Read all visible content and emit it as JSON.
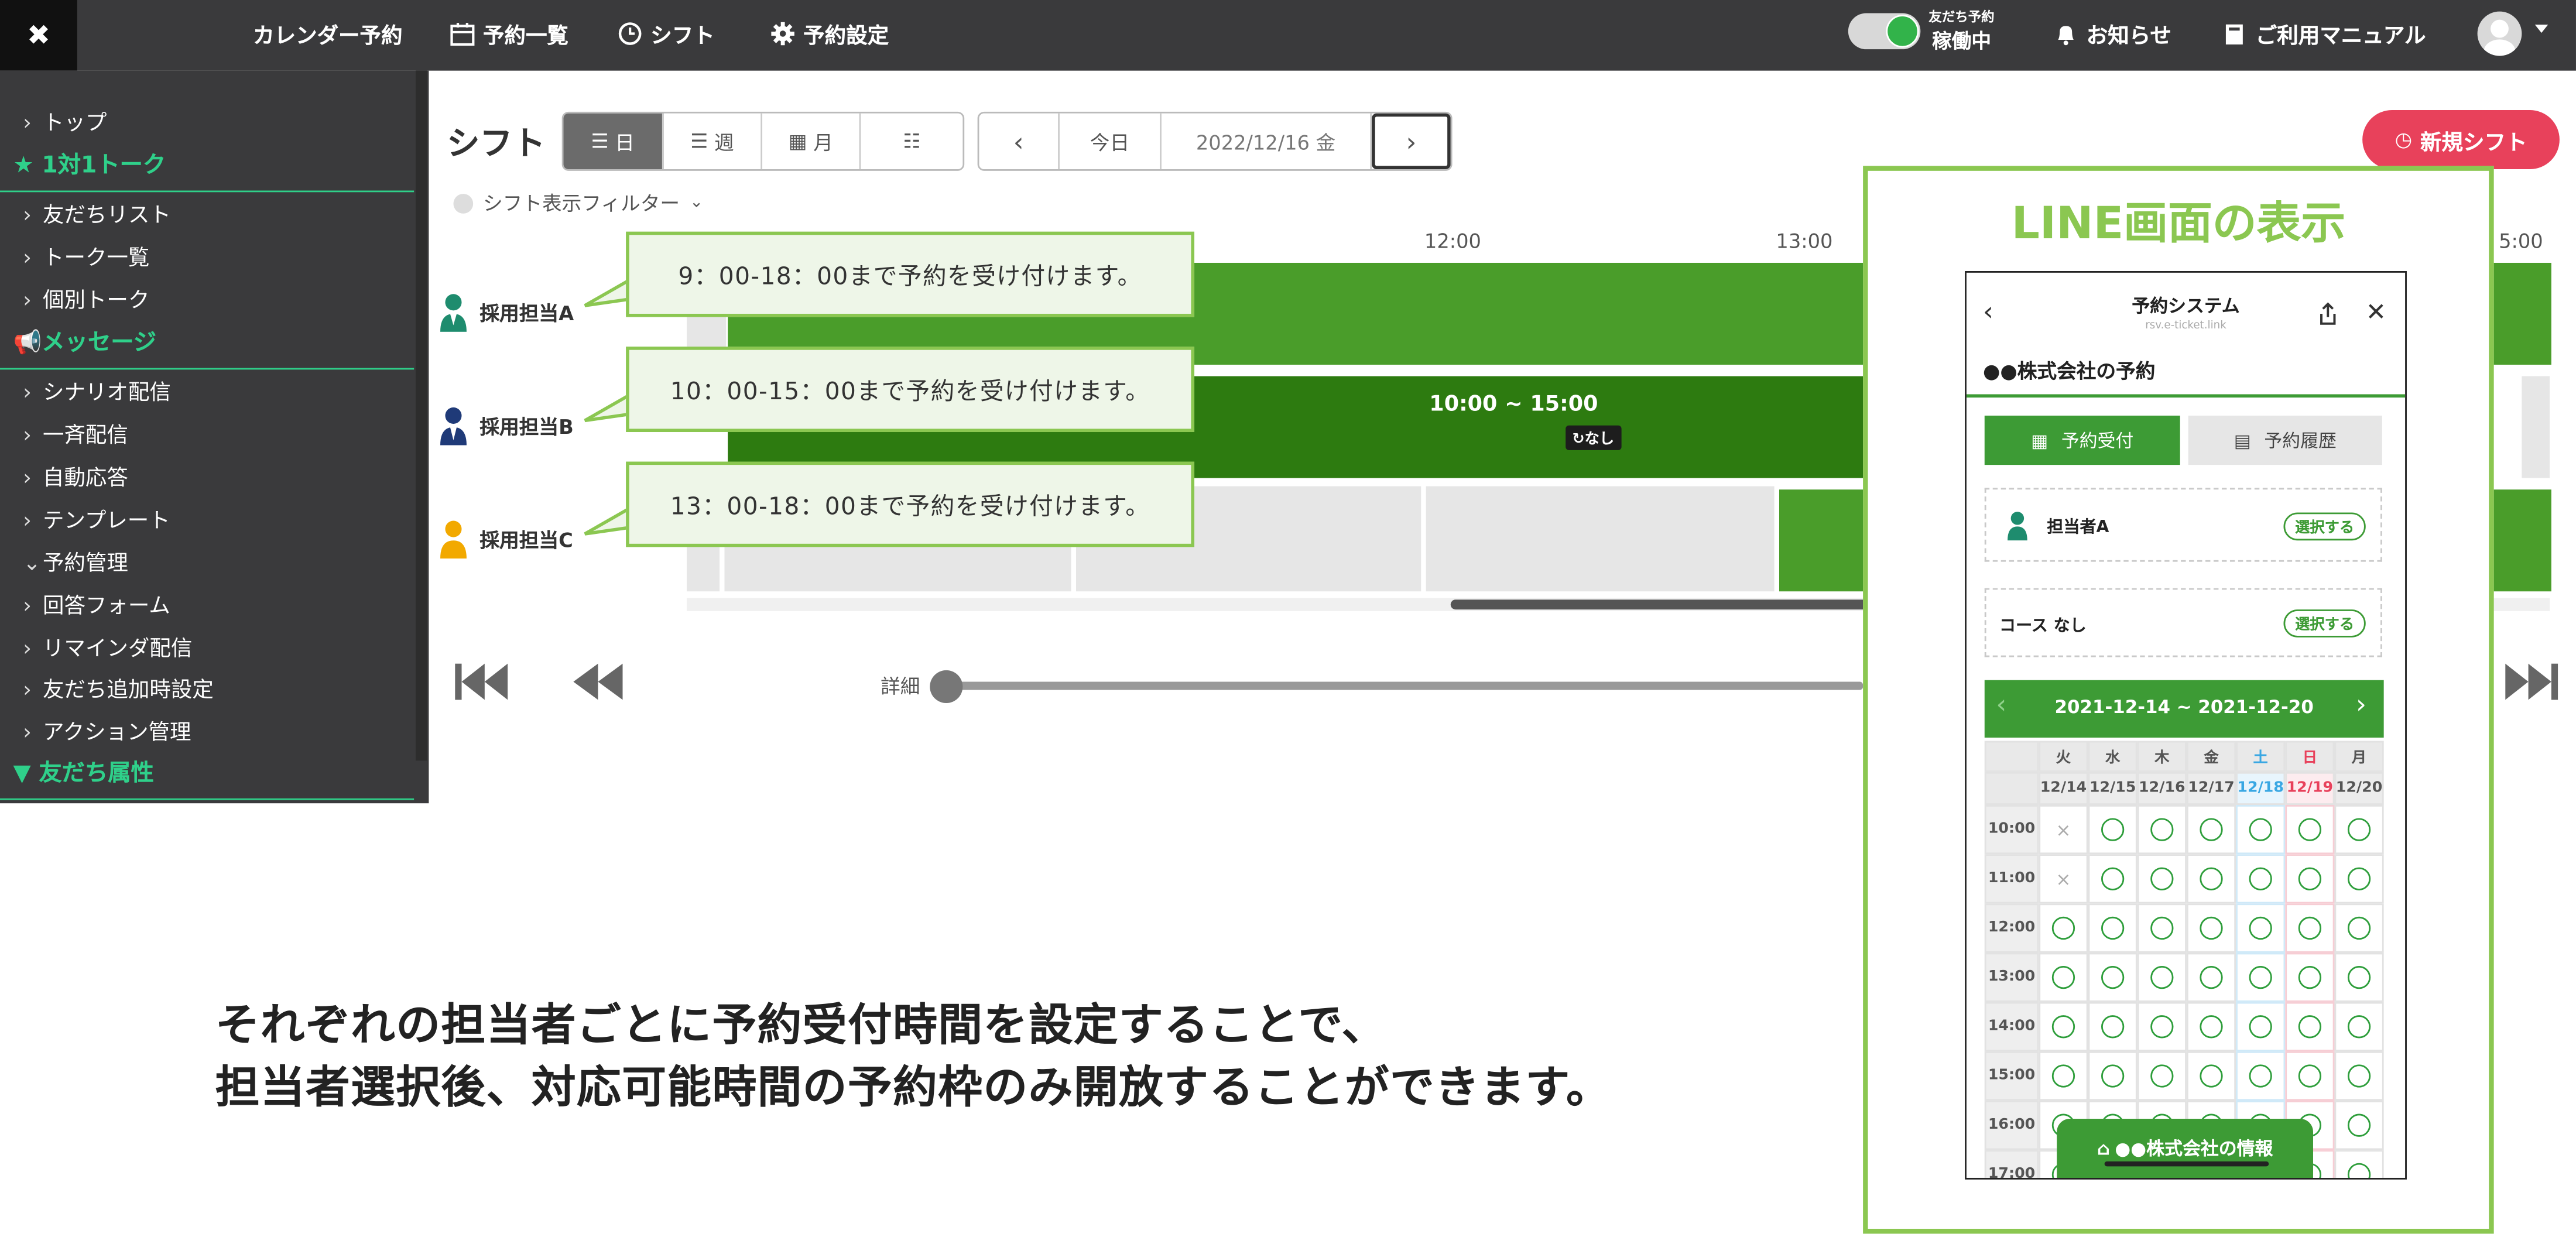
{
  "topbar": {
    "close_label": "✖",
    "nav": [
      {
        "label": "カレンダー予約",
        "icon": "calendar-icon"
      },
      {
        "label": "予約一覧",
        "icon": "calendar-grid-icon"
      },
      {
        "label": "シフト",
        "icon": "clock-icon"
      },
      {
        "label": "予約設定",
        "icon": "gear-icon"
      }
    ],
    "toggle_label_top": "友だち予約",
    "toggle_label_bottom": "稼働中",
    "notice": "お知らせ",
    "manual": "ご利用マニュアル"
  },
  "sidebar": {
    "items": [
      {
        "label": "トップ"
      },
      {
        "heading": "1対1トーク",
        "icon": "star-icon"
      },
      {
        "label": "友だちリスト"
      },
      {
        "label": "トーク一覧"
      },
      {
        "label": "個別トーク"
      },
      {
        "heading": "メッセージ",
        "icon": "megaphone-icon"
      },
      {
        "label": "シナリオ配信"
      },
      {
        "label": "一斉配信"
      },
      {
        "label": "自動応答"
      },
      {
        "label": "テンプレート"
      },
      {
        "label": "予約管理",
        "expanded": true
      },
      {
        "label": "回答フォーム"
      },
      {
        "label": "リマインダ配信"
      },
      {
        "label": "友だち追加時設定"
      },
      {
        "label": "アクション管理"
      },
      {
        "heading": "友だち属性",
        "icon": "filter-icon"
      }
    ]
  },
  "shift": {
    "title": "シフト",
    "view_buttons": [
      "日",
      "週",
      "月",
      ""
    ],
    "active_view": "日",
    "today_label": "今日",
    "date": "2022/12/16 金",
    "new_shift": "新規シフト",
    "filter_label": "シフト表示フィルター",
    "times": [
      "12:00",
      "13:00",
      "5:00"
    ],
    "staff": [
      "採用担当A",
      "採用担当B",
      "採用担当C"
    ],
    "bar_b_time": "10:00 ~ 15:00",
    "bar_b_repeat": "なし",
    "detail_label": "詳細"
  },
  "callouts": [
    "9：00-18：00まで予約を受け付けます。",
    "10：00-15：00まで予約を受け付けます。",
    "13：00-18：00まで予約を受け付けます。"
  ],
  "line": {
    "panel_title": "LINE画面の表示",
    "header_title": "予約システム",
    "header_url": "rsv.e-ticket.link",
    "company": "●●株式会社の予約",
    "tab_reserve": "予約受付",
    "tab_history": "予約履歴",
    "staff_label": "担当者A",
    "course_label": "コース なし",
    "select_label": "選択する",
    "week_range": "2021-12-14 ~ 2021-12-20",
    "days": [
      "火",
      "水",
      "木",
      "金",
      "土",
      "日",
      "月"
    ],
    "dates": [
      "12/14",
      "12/15",
      "12/16",
      "12/17",
      "12/18",
      "12/19",
      "12/20"
    ],
    "times": [
      "10:00",
      "11:00",
      "12:00",
      "13:00",
      "14:00",
      "15:00",
      "16:00",
      "17:00"
    ],
    "unavailable_mark": "×",
    "footer": "●●株式会社の情報"
  },
  "caption": {
    "line1": "それぞれの担当者ごとに予約受付時間を設定することで、",
    "line2": "担当者選択後、対応可能時間の予約枠のみ開放することができます。"
  },
  "colors": {
    "sidebar_bg": "#3a3a3c",
    "accent_green": "#2fd08a",
    "shift_green": "#4a9d2a",
    "line_green": "#3d9b35",
    "new_shift_red": "#e8415b",
    "callout_border": "#8bc751"
  }
}
